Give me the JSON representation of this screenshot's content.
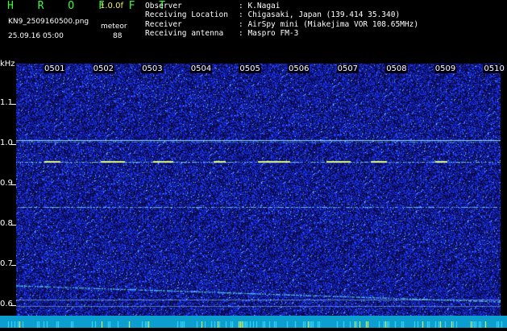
{
  "header": {
    "app_title": "H R O F F T",
    "version": "1.0.0f",
    "filename": "KN9_2509160500.png",
    "mode": "meteor",
    "datetime": "25.09.16 05:00",
    "count": "88"
  },
  "info": [
    {
      "key": "Observer",
      "value": ": K.Nagai"
    },
    {
      "key": "Receiving Location",
      "value": ": Chigasaki, Japan (139.414 35.340)"
    },
    {
      "key": "Receiver",
      "value": ": AirSpy mini (Miakejima VOR 108.65MHz)"
    },
    {
      "key": "Receiving antenna",
      "value": ": Maspro FM-3"
    }
  ],
  "plot": {
    "y_unit": "kHz",
    "y_ticks": [
      "1.1",
      "1.0",
      "0.9",
      "0.8",
      "0.7",
      "0.6"
    ],
    "x_ticks": [
      "0501",
      "0502",
      "0503",
      "0504",
      "0505",
      "0506",
      "0507",
      "0508",
      "0509",
      "0510"
    ],
    "colors": {
      "background": "#0a0a40",
      "noise": "#2a3cff",
      "signal": "#7fe6ff",
      "bottom_bar": "#0a9fcf"
    }
  }
}
